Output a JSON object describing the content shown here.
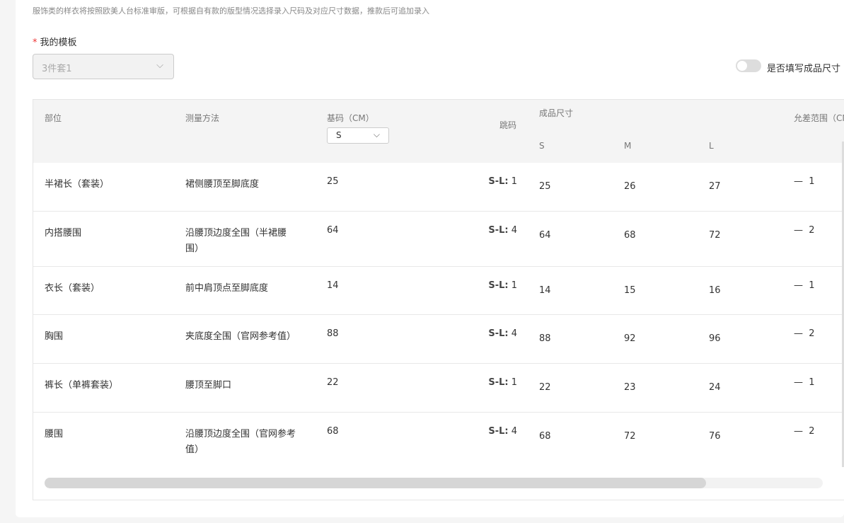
{
  "hint": "服饰类的样衣将按照欧美人台标准审版，可根据自有款的版型情况选择录入尺码及对应尺寸数据，推款后可追加录入",
  "template": {
    "required": "*",
    "label": "我的模板",
    "value": "3件套1"
  },
  "toggle": {
    "label": "是否填写成品尺寸",
    "on": false
  },
  "table": {
    "headers": {
      "part": "部位",
      "method": "测量方法",
      "base": "基码（CM）",
      "base_select": "S",
      "jump": "跳码",
      "finished": "成品尺寸",
      "sizes": [
        "S",
        "M",
        "L"
      ],
      "tolerance": "允差范围（CM）"
    },
    "rows": [
      {
        "part": "半裙长（套装）",
        "method": "裙侧腰顶至脚底度",
        "base": "25",
        "jump_label": "S-L:",
        "jump": "1",
        "s": "25",
        "m": "26",
        "l": "27",
        "tol_sign": "—",
        "tol": "1"
      },
      {
        "part": "内搭腰围",
        "method": "沿腰顶边度全围（半裙腰",
        "method2": "围）",
        "base": "64",
        "jump_label": "S-L:",
        "jump": "4",
        "s": "64",
        "m": "68",
        "l": "72",
        "tol_sign": "—",
        "tol": "2"
      },
      {
        "part": "衣长（套装）",
        "method": "前中肩顶点至脚底度",
        "base": "14",
        "jump_label": "S-L:",
        "jump": "1",
        "s": "14",
        "m": "15",
        "l": "16",
        "tol_sign": "—",
        "tol": "1"
      },
      {
        "part": "胸围",
        "method": "夹底度全围（官网参考值）",
        "base": "88",
        "jump_label": "S-L:",
        "jump": "4",
        "s": "88",
        "m": "92",
        "l": "96",
        "tol_sign": "—",
        "tol": "2"
      },
      {
        "part": "裤长（单裤套装）",
        "method": "腰顶至脚口",
        "base": "22",
        "jump_label": "S-L:",
        "jump": "1",
        "s": "22",
        "m": "23",
        "l": "24",
        "tol_sign": "—",
        "tol": "1"
      },
      {
        "part": "腰围",
        "method": "沿腰顶边度全围（官网参考",
        "method2": "值）",
        "base": "68",
        "jump_label": "S-L:",
        "jump": "4",
        "s": "68",
        "m": "72",
        "l": "76",
        "tol_sign": "—",
        "tol": "2"
      }
    ]
  },
  "scroll": {
    "horizontal_position_fraction": 0.0,
    "visible_fraction": 0.85
  }
}
